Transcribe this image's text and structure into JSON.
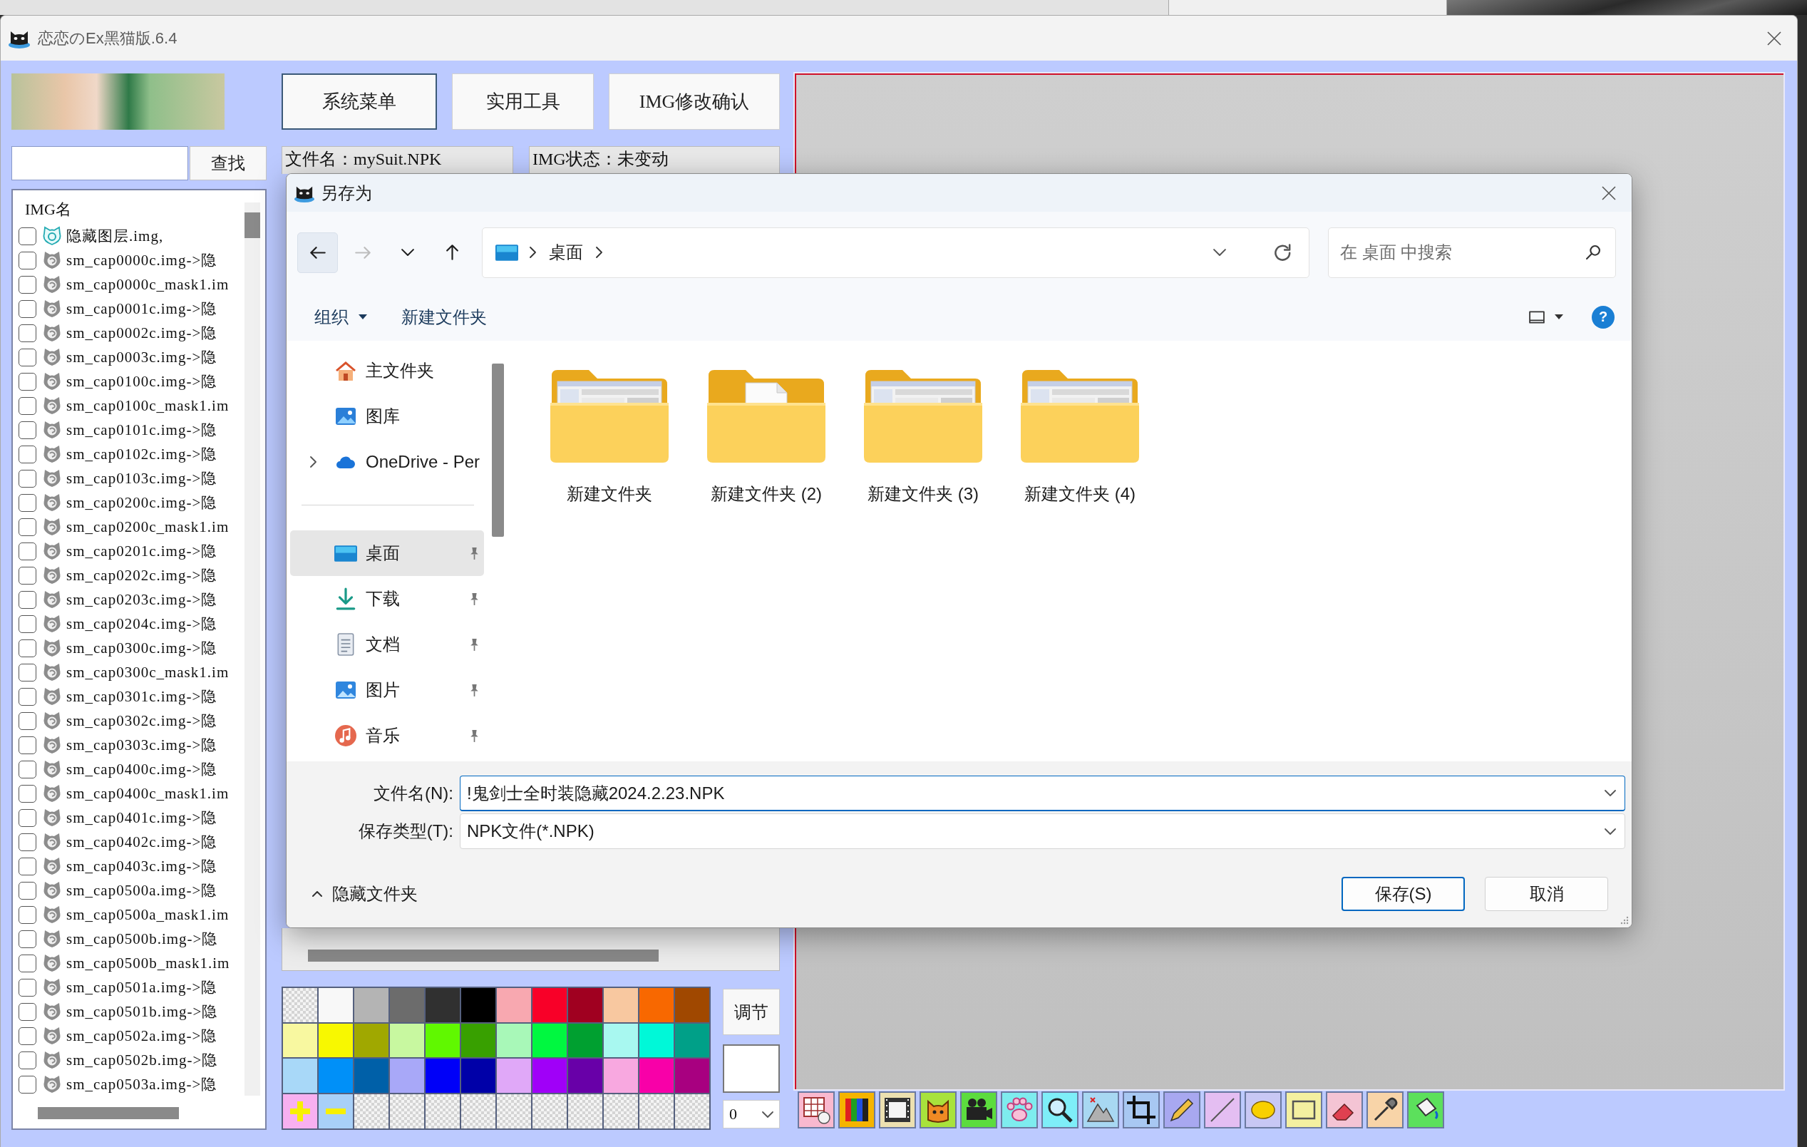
{
  "window": {
    "title": "恋恋のEx黑猫版.6.4"
  },
  "header_buttons": [
    {
      "label": "系统菜单",
      "focused": true
    },
    {
      "label": "实用工具",
      "focused": false
    },
    {
      "label": "IMG修改确认",
      "focused": false
    }
  ],
  "search": {
    "button": "查找"
  },
  "info": [
    "文件名：mySuit.NPK",
    "IMG状态：未变动"
  ],
  "img_list": {
    "header": "IMG名",
    "rows": [
      {
        "name": "隐藏图层.img,",
        "kind": "layer",
        "checked": false
      },
      {
        "name": "sm_cap0000c.img->隐",
        "kind": "img",
        "checked": false
      },
      {
        "name": "sm_cap0000c_mask1.im",
        "kind": "img",
        "checked": false
      },
      {
        "name": "sm_cap0001c.img->隐",
        "kind": "img",
        "checked": false
      },
      {
        "name": "sm_cap0002c.img->隐",
        "kind": "img",
        "checked": false
      },
      {
        "name": "sm_cap0003c.img->隐",
        "kind": "img",
        "checked": false
      },
      {
        "name": "sm_cap0100c.img->隐",
        "kind": "img",
        "checked": false
      },
      {
        "name": "sm_cap0100c_mask1.im",
        "kind": "img",
        "checked": false
      },
      {
        "name": "sm_cap0101c.img->隐",
        "kind": "img",
        "checked": false
      },
      {
        "name": "sm_cap0102c.img->隐",
        "kind": "img",
        "checked": false
      },
      {
        "name": "sm_cap0103c.img->隐",
        "kind": "img",
        "checked": false
      },
      {
        "name": "sm_cap0200c.img->隐",
        "kind": "img",
        "checked": false
      },
      {
        "name": "sm_cap0200c_mask1.im",
        "kind": "img",
        "checked": false
      },
      {
        "name": "sm_cap0201c.img->隐",
        "kind": "img",
        "checked": false
      },
      {
        "name": "sm_cap0202c.img->隐",
        "kind": "img",
        "checked": false
      },
      {
        "name": "sm_cap0203c.img->隐",
        "kind": "img",
        "checked": false
      },
      {
        "name": "sm_cap0204c.img->隐",
        "kind": "img",
        "checked": false
      },
      {
        "name": "sm_cap0300c.img->隐",
        "kind": "img",
        "checked": false
      },
      {
        "name": "sm_cap0300c_mask1.im",
        "kind": "img",
        "checked": false
      },
      {
        "name": "sm_cap0301c.img->隐",
        "kind": "img",
        "checked": false
      },
      {
        "name": "sm_cap0302c.img->隐",
        "kind": "img",
        "checked": false
      },
      {
        "name": "sm_cap0303c.img->隐",
        "kind": "img",
        "checked": false
      },
      {
        "name": "sm_cap0400c.img->隐",
        "kind": "img",
        "checked": false
      },
      {
        "name": "sm_cap0400c_mask1.im",
        "kind": "img",
        "checked": false
      },
      {
        "name": "sm_cap0401c.img->隐",
        "kind": "img",
        "checked": false
      },
      {
        "name": "sm_cap0402c.img->隐",
        "kind": "img",
        "checked": false
      },
      {
        "name": "sm_cap0403c.img->隐",
        "kind": "img",
        "checked": false
      },
      {
        "name": "sm_cap0500a.img->隐",
        "kind": "img",
        "checked": false
      },
      {
        "name": "sm_cap0500a_mask1.im",
        "kind": "img",
        "checked": false
      },
      {
        "name": "sm_cap0500b.img->隐",
        "kind": "img",
        "checked": false
      },
      {
        "name": "sm_cap0500b_mask1.im",
        "kind": "img",
        "checked": false
      },
      {
        "name": "sm_cap0501a.img->隐",
        "kind": "img",
        "checked": false
      },
      {
        "name": "sm_cap0501b.img->隐",
        "kind": "img",
        "checked": false
      },
      {
        "name": "sm_cap0502a.img->隐",
        "kind": "img",
        "checked": false
      },
      {
        "name": "sm_cap0502b.img->隐",
        "kind": "img",
        "checked": false
      },
      {
        "name": "sm_cap0503a.img->隐",
        "kind": "img",
        "checked": false
      }
    ]
  },
  "palette": {
    "swatches": [
      {
        "kind": "empty"
      },
      {
        "kind": "color",
        "color": "#f8f8f8"
      },
      {
        "kind": "color",
        "color": "#b4b4b4"
      },
      {
        "kind": "color",
        "color": "#6c6c6c"
      },
      {
        "kind": "color",
        "color": "#303030"
      },
      {
        "kind": "color",
        "color": "#000000"
      },
      {
        "kind": "color",
        "color": "#f8a8b0"
      },
      {
        "kind": "color",
        "color": "#f80028"
      },
      {
        "kind": "color",
        "color": "#a00020"
      },
      {
        "kind": "color",
        "color": "#f8c8a0"
      },
      {
        "kind": "color",
        "color": "#f86800"
      },
      {
        "kind": "color",
        "color": "#a04800"
      },
      {
        "kind": "color",
        "color": "#f8f8a0"
      },
      {
        "kind": "color",
        "color": "#f8f800"
      },
      {
        "kind": "color",
        "color": "#a0a800"
      },
      {
        "kind": "color",
        "color": "#c8f8a0"
      },
      {
        "kind": "color",
        "color": "#60f800"
      },
      {
        "kind": "color",
        "color": "#38a000"
      },
      {
        "kind": "color",
        "color": "#a8f8b8"
      },
      {
        "kind": "color",
        "color": "#00f840"
      },
      {
        "kind": "color",
        "color": "#00a030"
      },
      {
        "kind": "color",
        "color": "#a8f8f0"
      },
      {
        "kind": "color",
        "color": "#00f8d8"
      },
      {
        "kind": "color",
        "color": "#00a088"
      },
      {
        "kind": "color",
        "color": "#a8d8f8"
      },
      {
        "kind": "color",
        "color": "#0090f8"
      },
      {
        "kind": "color",
        "color": "#0060a8"
      },
      {
        "kind": "color",
        "color": "#a8a8f8"
      },
      {
        "kind": "color",
        "color": "#0000f8"
      },
      {
        "kind": "color",
        "color": "#0000a8"
      },
      {
        "kind": "color",
        "color": "#e0a8f8"
      },
      {
        "kind": "color",
        "color": "#a000f8"
      },
      {
        "kind": "color",
        "color": "#6800a8"
      },
      {
        "kind": "color",
        "color": "#f8a8e0"
      },
      {
        "kind": "color",
        "color": "#f800a8"
      },
      {
        "kind": "color",
        "color": "#a80080"
      },
      {
        "kind": "add"
      },
      {
        "kind": "remove"
      },
      {
        "kind": "empty"
      },
      {
        "kind": "empty"
      },
      {
        "kind": "empty"
      },
      {
        "kind": "empty"
      },
      {
        "kind": "empty"
      },
      {
        "kind": "empty"
      },
      {
        "kind": "empty"
      },
      {
        "kind": "empty"
      },
      {
        "kind": "empty"
      },
      {
        "kind": "empty"
      }
    ],
    "adjust_button": "调节",
    "dropdown": "0"
  },
  "save_dialog": {
    "title": "另存为",
    "nav_buttons": [
      {
        "kind": "back",
        "disabled": false,
        "focused": true
      },
      {
        "kind": "forward",
        "disabled": true,
        "focused": false
      },
      {
        "kind": "recent",
        "disabled": false,
        "focused": false
      },
      {
        "kind": "up",
        "disabled": false,
        "focused": false
      }
    ],
    "address": {
      "crumbs": [
        "桌面"
      ]
    },
    "search": {
      "placeholder": "在 桌面 中搜索"
    },
    "commands": [
      {
        "label": "组织",
        "kind": "menu"
      },
      {
        "label": "新建文件夹",
        "kind": "button"
      }
    ],
    "help": "?",
    "nav_pane": {
      "sections": [
        {
          "items": [
            {
              "label": "主文件夹",
              "kind": "home",
              "selected": false,
              "pinned": false,
              "expandable": false
            },
            {
              "label": "图库",
              "kind": "gallery",
              "selected": false,
              "pinned": false,
              "expandable": false
            },
            {
              "label": "OneDrive - Per",
              "kind": "cloud",
              "selected": false,
              "pinned": false,
              "expandable": true
            }
          ]
        },
        {
          "items": [
            {
              "label": "桌面",
              "kind": "desktop",
              "selected": true,
              "pinned": true,
              "expandable": false
            },
            {
              "label": "下载",
              "kind": "download",
              "selected": false,
              "pinned": true,
              "expandable": false
            },
            {
              "label": "文档",
              "kind": "documents",
              "selected": false,
              "pinned": true,
              "expandable": false
            },
            {
              "label": "图片",
              "kind": "pictures",
              "selected": false,
              "pinned": true,
              "expandable": false
            },
            {
              "label": "音乐",
              "kind": "music",
              "selected": false,
              "pinned": true,
              "expandable": false
            }
          ]
        }
      ]
    },
    "folders": [
      {
        "label": "新建文件夹",
        "kind": "window",
        "selected": false
      },
      {
        "label": "新建文件夹 (2)",
        "kind": "page",
        "selected": false
      },
      {
        "label": "新建文件夹 (3)",
        "kind": "window",
        "selected": false
      },
      {
        "label": "新建文件夹 (4)",
        "kind": "window",
        "selected": false
      }
    ],
    "fields": [
      {
        "label": "文件名(N):",
        "value": "!鬼剑士全时装隐藏2024.2.23.NPK",
        "focused": true
      },
      {
        "label": "保存类型(T):",
        "value": "NPK文件(*.NPK)",
        "focused": false
      }
    ],
    "hidden_folders_toggle": {
      "label": "隐藏文件夹",
      "expanded": true
    },
    "buttons": [
      {
        "label": "保存(S)",
        "default": true
      },
      {
        "label": "取消",
        "default": false
      }
    ]
  }
}
